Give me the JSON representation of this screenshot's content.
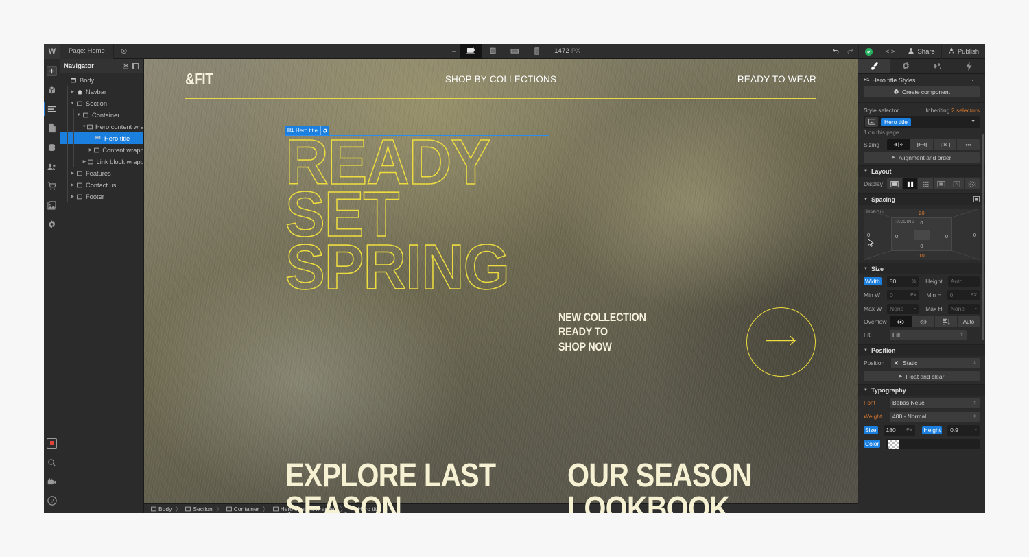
{
  "topbar": {
    "logo": "W",
    "page_label": "Page: Home",
    "preview_icon": "eye-icon",
    "breakpoints": [
      {
        "name": "desktop",
        "icon": "desktop-icon",
        "active": true
      },
      {
        "name": "tablet",
        "icon": "tablet-icon",
        "active": false
      },
      {
        "name": "mobile-landscape",
        "icon": "mobile-landscape-icon",
        "active": false
      },
      {
        "name": "mobile-portrait",
        "icon": "mobile-portrait-icon",
        "active": false
      }
    ],
    "canvas_width": "1472",
    "canvas_width_unit": "PX",
    "undo_icon": "undo-icon",
    "redo_icon": "redo-icon",
    "status_icon": "check-circle-icon",
    "code_label": "< >",
    "share_label": "Share",
    "publish_label": "Publish"
  },
  "left_toolbar": {
    "items": [
      {
        "name": "add-elements",
        "icon": "plus-icon"
      },
      {
        "name": "components",
        "icon": "cube-icon"
      },
      {
        "name": "navigator",
        "icon": "layers-icon",
        "selected": true
      },
      {
        "name": "pages",
        "icon": "page-icon"
      },
      {
        "name": "cms",
        "icon": "database-icon"
      },
      {
        "name": "users",
        "icon": "users-icon"
      },
      {
        "name": "ecommerce",
        "icon": "cart-icon"
      },
      {
        "name": "assets",
        "icon": "image-stack-icon"
      },
      {
        "name": "settings",
        "icon": "gear-icon"
      }
    ],
    "bottom_items": [
      {
        "name": "interactions",
        "icon": "record-square-icon"
      },
      {
        "name": "search",
        "icon": "search-icon"
      },
      {
        "name": "video-tutorials",
        "icon": "video-camera-icon"
      },
      {
        "name": "help",
        "icon": "question-circle-icon"
      }
    ]
  },
  "navigator": {
    "title": "Navigator",
    "collapse_icon": "collapse-all-icon",
    "panel_icon": "panel-toggle-icon",
    "tree": [
      {
        "label": "Body",
        "depth": 0,
        "icon": "body-icon",
        "arrow": "",
        "selected": false
      },
      {
        "label": "Navbar",
        "depth": 1,
        "icon": "navbar-icon",
        "arrow": "right",
        "selected": false
      },
      {
        "label": "Section",
        "depth": 1,
        "icon": "box-icon",
        "arrow": "down",
        "selected": false
      },
      {
        "label": "Container",
        "depth": 2,
        "icon": "box-icon",
        "arrow": "down",
        "selected": false
      },
      {
        "label": "Hero content wrappe",
        "depth": 3,
        "icon": "box-icon",
        "arrow": "down",
        "selected": false
      },
      {
        "label": "Hero title",
        "depth": 4,
        "icon": "h1-icon",
        "arrow": "",
        "selected": true
      },
      {
        "label": "Content wrapper",
        "depth": 4,
        "icon": "box-icon",
        "arrow": "right",
        "selected": false
      },
      {
        "label": "Link block wrapper",
        "depth": 3,
        "icon": "box-icon",
        "arrow": "right",
        "selected": false
      },
      {
        "label": "Features",
        "depth": 1,
        "icon": "box-icon",
        "arrow": "right",
        "selected": false
      },
      {
        "label": "Contact us",
        "depth": 1,
        "icon": "box-icon",
        "arrow": "right",
        "selected": false
      },
      {
        "label": "Footer",
        "depth": 1,
        "icon": "box-icon",
        "arrow": "right",
        "selected": false
      }
    ]
  },
  "canvas": {
    "site": {
      "brand": "&FIT",
      "nav_center": "SHOP BY COLLECTIONS",
      "nav_right": "READY TO WEAR",
      "hero_title": "READY SET SPRING",
      "hero_title_lines": [
        "READY",
        "SET",
        "SPRING"
      ],
      "collection_lines": [
        "NEW COLLECTION",
        "READY TO",
        "SHOP NOW"
      ],
      "arrow_icon": "arrow-right-icon",
      "bottom_links": [
        "EXPLORE LAST SEASON",
        "OUR SEASON LOOKBOOK"
      ]
    },
    "selection_badge": {
      "tag": "H1",
      "label": "Hero title",
      "settings_icon": "gear-icon"
    },
    "colors": {
      "accent_yellow": "#ecdc3f",
      "cream": "#f5f1d2",
      "selection_blue": "#1b7fe0"
    }
  },
  "breadcrumb": [
    {
      "label": "Body",
      "icon": "box-icon"
    },
    {
      "label": "Section",
      "icon": "box-icon"
    },
    {
      "label": "Container",
      "icon": "box-icon"
    },
    {
      "label": "Hero content wrapper",
      "icon": "box-icon"
    },
    {
      "label": "Hero title",
      "icon": "h1-icon"
    }
  ],
  "style_panel": {
    "tabs": [
      {
        "name": "style",
        "icon": "paintbrush-icon",
        "active": true
      },
      {
        "name": "settings",
        "icon": "gear-icon",
        "active": false
      },
      {
        "name": "interactions",
        "icon": "interactions-icon",
        "active": false
      },
      {
        "name": "effects",
        "icon": "lightning-icon",
        "active": false
      }
    ],
    "header": {
      "tag": "H1",
      "title": "Hero title Styles",
      "menu": "···"
    },
    "create_component": {
      "label": "Create component",
      "icon": "component-icon"
    },
    "style_selector": {
      "label": "Style selector",
      "inheriting_prefix": "Inheriting",
      "inheriting_count": "2 selectors",
      "chip": "Hero title",
      "indicator_icon": "selector-state-icon",
      "caret_icon": "chevron-down-icon",
      "usage": "1 on this page"
    },
    "sizing": {
      "label": "Sizing",
      "options": [
        {
          "name": "shrink",
          "icon": "shrink-icon",
          "active": true
        },
        {
          "name": "grow",
          "icon": "grow-icon",
          "active": false
        },
        {
          "name": "fixed",
          "icon": "fixed-icon",
          "active": false
        },
        {
          "name": "more",
          "icon": "more-icon",
          "active": false
        }
      ],
      "alignment_label": "Alignment and order"
    },
    "layout": {
      "title": "Layout",
      "display_label": "Display",
      "options": [
        {
          "name": "block",
          "icon": "display-block-icon",
          "active": false
        },
        {
          "name": "flex",
          "icon": "display-flex-icon",
          "active": true
        },
        {
          "name": "grid",
          "icon": "display-grid-icon",
          "active": false
        },
        {
          "name": "inline-block",
          "icon": "display-inline-block-icon",
          "active": false
        },
        {
          "name": "inline",
          "icon": "display-inline-icon",
          "active": false
        },
        {
          "name": "none",
          "icon": "display-none-icon",
          "active": false
        }
      ]
    },
    "spacing": {
      "title": "Spacing",
      "mode_icon": "spacing-mode-icon",
      "margin_label": "MARGIN",
      "padding_label": "PADDING",
      "margin": {
        "top": "20",
        "right": "0",
        "bottom": "10",
        "left": "0"
      },
      "padding": {
        "top": "0",
        "right": "0",
        "bottom": "0",
        "left": "0"
      }
    },
    "size": {
      "title": "Size",
      "width_label": "Width",
      "width_value": "50",
      "width_unit": "%",
      "height_label": "Height",
      "height_value": "Auto",
      "height_unit": "-",
      "minw_label": "Min W",
      "minw_value": "0",
      "minw_unit": "PX",
      "minh_label": "Min H",
      "minh_value": "0",
      "minh_unit": "PX",
      "maxw_label": "Max W",
      "maxw_value": "None",
      "maxw_unit": "-",
      "maxh_label": "Max H",
      "maxh_value": "None",
      "maxh_unit": "-",
      "overflow_label": "Overflow",
      "overflow_options": [
        {
          "name": "visible",
          "icon": "eye-icon",
          "active": true
        },
        {
          "name": "hidden",
          "icon": "eye-off-icon",
          "active": false
        },
        {
          "name": "scroll",
          "icon": "scroll-icon",
          "active": false
        },
        {
          "name": "auto",
          "icon": "",
          "label": "Auto",
          "active": false
        }
      ],
      "fit_label": "Fit",
      "fit_value": "Fill",
      "fit_menu": "···"
    },
    "position": {
      "title": "Position",
      "position_label": "Position",
      "position_value": "Static",
      "position_icon": "static-x-icon",
      "float_label": "Float and clear"
    },
    "typography": {
      "title": "Typography",
      "font_label": "Font",
      "font_value": "Bebas Neue",
      "weight_label": "Weight",
      "weight_value": "400 - Normal",
      "size_label": "Size",
      "size_value": "180",
      "size_unit": "PX",
      "height_label": "Height",
      "height_value": "0.9",
      "height_unit": "-",
      "color_label": "Color",
      "color_swatch": "transparent-checker"
    }
  }
}
